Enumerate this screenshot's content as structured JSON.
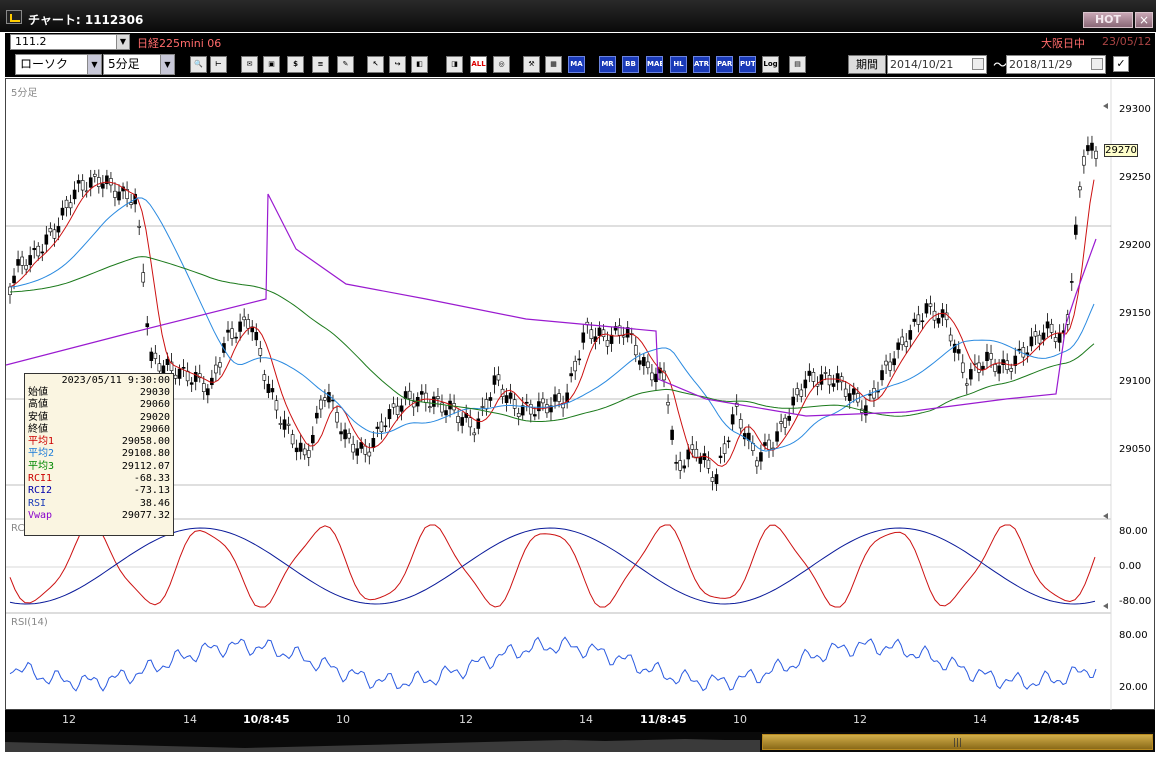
{
  "window": {
    "title": "チャート: 1112306",
    "hot_label": "HOT",
    "close_label": "×"
  },
  "symbol_bar": {
    "code": "111.2",
    "name": "日経225mini 06",
    "market_status": "大阪日中",
    "date": "23/05/12"
  },
  "toolbar": {
    "chart_type": "ローソク",
    "interval": "5分足",
    "buttons": [
      {
        "label": "🔍",
        "icon": "magnifier-icon"
      },
      {
        "label": "⊢",
        "icon": "cursor-icon"
      },
      {
        "label": "✉",
        "icon": "alert-icon"
      },
      {
        "label": "▣",
        "icon": "screenshot-icon"
      },
      {
        "label": "$",
        "icon": "trade-icon"
      },
      {
        "label": "≡",
        "icon": "list-icon"
      },
      {
        "label": "✎",
        "icon": "draw-icon"
      },
      {
        "label": "↖",
        "icon": "pointer-icon"
      },
      {
        "label": "↪",
        "icon": "undo-icon"
      },
      {
        "label": "◧",
        "icon": "indicator-icon"
      },
      {
        "label": "◨",
        "icon": "indicator2-icon"
      },
      {
        "label": "ALL",
        "icon": "all-icon"
      },
      {
        "label": "◎",
        "icon": "settings-icon"
      },
      {
        "label": "⚒",
        "icon": "tools-icon"
      },
      {
        "label": "▦",
        "icon": "color-icon"
      },
      {
        "label": "MA",
        "icon": "ma-icon"
      },
      {
        "label": "MR",
        "icon": "mr-icon"
      },
      {
        "label": "BB",
        "icon": "bb-icon"
      },
      {
        "label": "MAE",
        "icon": "mae-icon"
      },
      {
        "label": "HL",
        "icon": "hl-icon"
      },
      {
        "label": "ATR",
        "icon": "atr-icon"
      },
      {
        "label": "PARA",
        "icon": "para-icon"
      },
      {
        "label": "PUT",
        "icon": "put-icon"
      },
      {
        "label": "Log",
        "icon": "log-icon"
      },
      {
        "label": "▤",
        "icon": "export-icon"
      }
    ],
    "period_label": "期間",
    "date_from": "2014/10/21",
    "date_to": "2018/11/29",
    "range_sep": "〜"
  },
  "main_panel": {
    "label": "5分足",
    "y_ticks": [
      "29300",
      "29250",
      "29200",
      "29150",
      "29100",
      "29050"
    ],
    "last_price": "29270"
  },
  "rci_panel": {
    "label": "RCI",
    "y_ticks": [
      "80.00",
      "0.00",
      "-80.00"
    ]
  },
  "rsi_panel": {
    "label": "RSI(14)",
    "y_ticks": [
      "80.00",
      "20.00"
    ]
  },
  "x_ticks": [
    {
      "label": "12",
      "bold": false
    },
    {
      "label": "14",
      "bold": false
    },
    {
      "label": "10/8:45",
      "bold": true
    },
    {
      "label": "10",
      "bold": false
    },
    {
      "label": "12",
      "bold": false
    },
    {
      "label": "14",
      "bold": false
    },
    {
      "label": "11/8:45",
      "bold": true
    },
    {
      "label": "10",
      "bold": false
    },
    {
      "label": "12",
      "bold": false
    },
    {
      "label": "14",
      "bold": false
    },
    {
      "label": "12/8:45",
      "bold": true
    }
  ],
  "info": {
    "datetime": "2023/05/11 9:30:00",
    "rows": [
      {
        "label": "始値",
        "value": "29030",
        "color": "#000000"
      },
      {
        "label": "高値",
        "value": "29060",
        "color": "#000000"
      },
      {
        "label": "安値",
        "value": "29020",
        "color": "#000000"
      },
      {
        "label": "終値",
        "value": "29060",
        "color": "#000000"
      },
      {
        "label": "平均1",
        "value": "29058.00",
        "color": "#cc0000"
      },
      {
        "label": "平均2",
        "value": "29108.80",
        "color": "#1a7ad9"
      },
      {
        "label": "平均3",
        "value": "29112.07",
        "color": "#008800"
      },
      {
        "label": "RCI1",
        "value": "-68.33",
        "color": "#cc0000"
      },
      {
        "label": "RCI2",
        "value": "-73.13",
        "color": "#0000aa"
      },
      {
        "label": "RSI",
        "value": "38.46",
        "color": "#1a3ab8"
      },
      {
        "label": "Vwap",
        "value": "29077.32",
        "color": "#8800cc"
      }
    ]
  },
  "colors": {
    "ma1": "#cc1111",
    "ma2": "#2a8ae0",
    "ma3": "#1c7a1c",
    "vwap": "#9a1ad0",
    "rci1": "#cc1111",
    "rci2": "#0a1a9a",
    "rsi": "#2a5ae0",
    "scroll": "#c9a23a"
  }
}
